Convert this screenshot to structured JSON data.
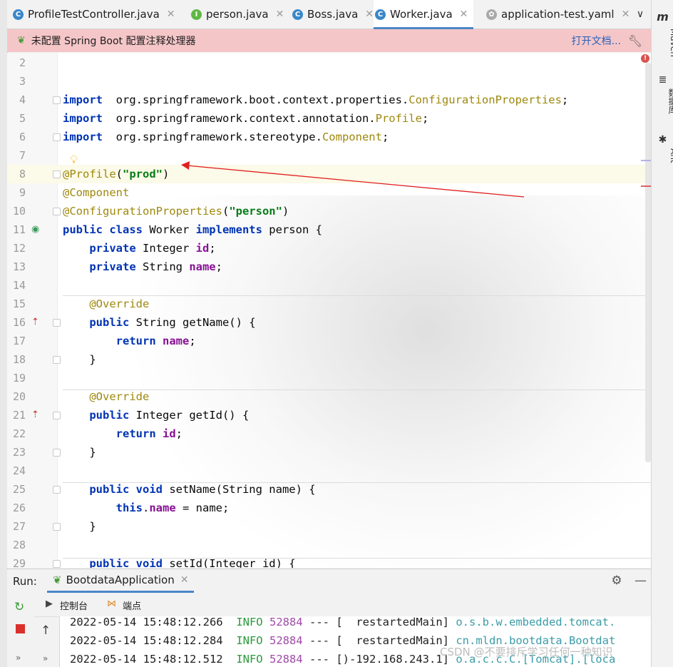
{
  "tabs": [
    {
      "label": "ProfileTestController.java",
      "icon": "class-icon",
      "active": false
    },
    {
      "label": "person.java",
      "icon": "interface-icon",
      "active": false
    },
    {
      "label": "Boss.java",
      "icon": "class-icon",
      "active": false
    },
    {
      "label": "Worker.java",
      "icon": "class-icon",
      "active": true
    },
    {
      "label": "application-test.yaml",
      "icon": "yaml-icon",
      "active": false
    }
  ],
  "banner": {
    "message": "未配置 Spring Boot 配置注释处理器",
    "link": "打开文档..."
  },
  "right_toolbar": {
    "maven": "Maven",
    "database": "数据库",
    "ant": "Ant"
  },
  "editor": {
    "lines": [
      {
        "n": "2",
        "tokens": []
      },
      {
        "n": "3",
        "tokens": []
      },
      {
        "n": "4",
        "tokens": [
          [
            "kw",
            "import"
          ],
          [
            "",
            "  org.springframework.boot.context.properties."
          ],
          [
            "cls",
            "ConfigurationProperties"
          ],
          [
            "",
            ";"
          ]
        ]
      },
      {
        "n": "5",
        "tokens": [
          [
            "kw",
            "import"
          ],
          [
            "",
            "  org.springframework.context.annotation."
          ],
          [
            "cls",
            "Profile"
          ],
          [
            "",
            ";"
          ]
        ]
      },
      {
        "n": "6",
        "tokens": [
          [
            "kw",
            "import"
          ],
          [
            "",
            "  org.springframework.stereotype."
          ],
          [
            "cls",
            "Component"
          ],
          [
            "",
            ";"
          ]
        ]
      },
      {
        "n": "7",
        "tokens": []
      },
      {
        "n": "8",
        "tokens": [
          [
            "ann",
            "@Profile"
          ],
          [
            "",
            "("
          ],
          [
            "str",
            "\"prod\""
          ],
          [
            "",
            ")"
          ]
        ]
      },
      {
        "n": "9",
        "tokens": [
          [
            "ann",
            "@Component"
          ]
        ]
      },
      {
        "n": "10",
        "tokens": [
          [
            "ann",
            "@ConfigurationProperties"
          ],
          [
            "",
            "("
          ],
          [
            "str",
            "\"person\""
          ],
          [
            "",
            ")"
          ]
        ]
      },
      {
        "n": "11",
        "tokens": [
          [
            "kw",
            "public class"
          ],
          [
            "",
            " Worker "
          ],
          [
            "kw",
            "implements"
          ],
          [
            "",
            " person {"
          ]
        ]
      },
      {
        "n": "12",
        "tokens": [
          [
            "",
            "    "
          ],
          [
            "kw",
            "private"
          ],
          [
            "",
            " Integer "
          ],
          [
            "fld",
            "id"
          ],
          [
            "",
            ";"
          ]
        ]
      },
      {
        "n": "13",
        "tokens": [
          [
            "",
            "    "
          ],
          [
            "kw",
            "private"
          ],
          [
            "",
            " String "
          ],
          [
            "fld",
            "name"
          ],
          [
            "",
            ";"
          ]
        ]
      },
      {
        "n": "14",
        "tokens": []
      },
      {
        "n": "15",
        "tokens": [
          [
            "",
            "    "
          ],
          [
            "ann",
            "@Override"
          ]
        ]
      },
      {
        "n": "16",
        "tokens": [
          [
            "",
            "    "
          ],
          [
            "kw",
            "public"
          ],
          [
            "",
            " String getName() {"
          ]
        ]
      },
      {
        "n": "17",
        "tokens": [
          [
            "",
            "        "
          ],
          [
            "kw",
            "return"
          ],
          [
            "",
            " "
          ],
          [
            "fld",
            "name"
          ],
          [
            "",
            ";"
          ]
        ]
      },
      {
        "n": "18",
        "tokens": [
          [
            "",
            "    }"
          ]
        ]
      },
      {
        "n": "19",
        "tokens": []
      },
      {
        "n": "20",
        "tokens": [
          [
            "",
            "    "
          ],
          [
            "ann",
            "@Override"
          ]
        ]
      },
      {
        "n": "21",
        "tokens": [
          [
            "",
            "    "
          ],
          [
            "kw",
            "public"
          ],
          [
            "",
            " Integer getId() {"
          ]
        ]
      },
      {
        "n": "22",
        "tokens": [
          [
            "",
            "        "
          ],
          [
            "kw",
            "return"
          ],
          [
            "",
            " "
          ],
          [
            "fld",
            "id"
          ],
          [
            "",
            ";"
          ]
        ]
      },
      {
        "n": "23",
        "tokens": [
          [
            "",
            "    }"
          ]
        ]
      },
      {
        "n": "24",
        "tokens": []
      },
      {
        "n": "25",
        "tokens": [
          [
            "",
            "    "
          ],
          [
            "kw",
            "public void"
          ],
          [
            "",
            " setName(String name) {"
          ]
        ]
      },
      {
        "n": "26",
        "tokens": [
          [
            "",
            "        "
          ],
          [
            "kw",
            "this"
          ],
          [
            "",
            "."
          ],
          [
            "fld",
            "name"
          ],
          [
            "",
            " = name;"
          ]
        ]
      },
      {
        "n": "27",
        "tokens": [
          [
            "",
            "    }"
          ]
        ]
      },
      {
        "n": "28",
        "tokens": []
      },
      {
        "n": "29",
        "tokens": [
          [
            "",
            "    "
          ],
          [
            "kw",
            "public void"
          ],
          [
            "",
            " setId(Integer id) {"
          ]
        ]
      }
    ]
  },
  "run": {
    "label": "Run:",
    "config": "BootdataApplication",
    "console_tab": "控制台",
    "endpoints_tab": "端点",
    "log": [
      {
        "ts": "2022-05-14 15:48:12.266",
        "level": "INFO",
        "pid": "52884",
        "sep": "---",
        "thread": "[  restartedMain]",
        "logger": "o.s.b.w.embedded.tomcat."
      },
      {
        "ts": "2022-05-14 15:48:12.284",
        "level": "INFO",
        "pid": "52884",
        "sep": "---",
        "thread": "[  restartedMain]",
        "logger": "cn.mldn.bootdata.Bootdat"
      },
      {
        "ts": "2022-05-14 15:48:12.512",
        "level": "INFO",
        "pid": "52884",
        "sep": "---",
        "thread": "[)-192.168.243.1]",
        "logger": "o.a.c.c.C.[Tomcat].[loca"
      }
    ]
  },
  "watermark": "CSDN @不要排斥学习任何一种知识"
}
